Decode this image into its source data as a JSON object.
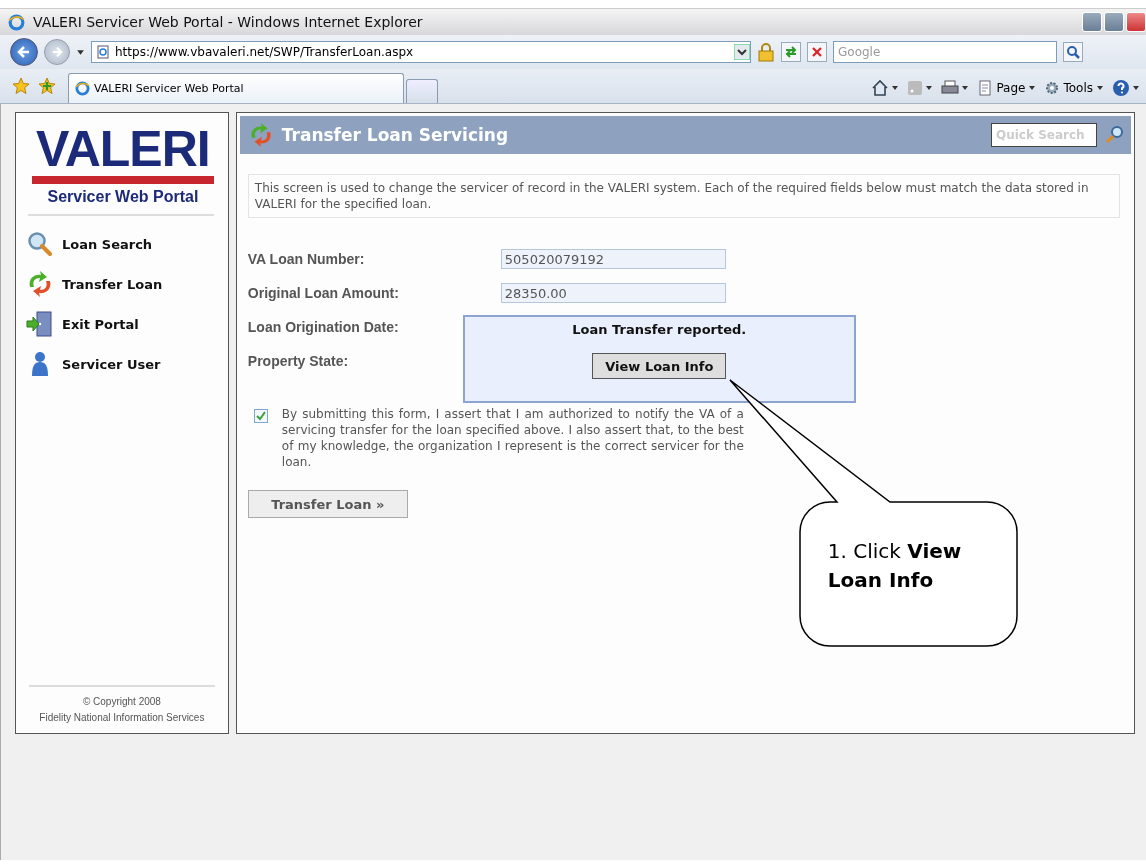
{
  "window": {
    "title": "VALERI Servicer Web Portal - Windows Internet Explorer"
  },
  "address_bar": {
    "url": "https://www.vbavaleri.net/SWP/TransferLoan.aspx"
  },
  "search_box": {
    "placeholder": "Google"
  },
  "tabs": [
    {
      "label": "VALERI Servicer Web Portal",
      "selected": true
    }
  ],
  "command_bar": [
    "Page",
    "Tools"
  ],
  "sidebar": {
    "logo": {
      "title": "VALERI",
      "subtitle": "Servicer Web Portal"
    },
    "items": [
      {
        "label": "Loan Search",
        "kind": "search"
      },
      {
        "label": "Transfer Loan",
        "kind": "transfer"
      },
      {
        "label": "Exit Portal",
        "kind": "exit"
      },
      {
        "label": "Servicer User",
        "kind": "user"
      }
    ],
    "copyright": "© Copyright 2008",
    "company": "Fidelity National Information Services"
  },
  "page": {
    "title": "Transfer Loan Servicing",
    "quick_search": {
      "placeholder": "Quick Search"
    },
    "intro": "This screen is used to change the servicer of record in the VALERI system. Each of the required fields below must match the data stored in VALERI for the specified loan.",
    "fields": [
      {
        "label": "VA Loan Number:",
        "value": "505020079192"
      },
      {
        "label": "Original Loan Amount:",
        "value": "28350.00"
      },
      {
        "label": "Loan Origination Date:"
      },
      {
        "label": "Property State:"
      }
    ],
    "agreement": {
      "checked": true,
      "text": "By submitting this form, I assert that I am authorized to notify the VA of a servicing transfer for the loan specified above. I also assert that, to the best of my knowledge, the organization I represent is the correct servicer for the loan."
    },
    "submit_button": "Transfer Loan »"
  },
  "popup": {
    "message": "Loan Transfer reported.",
    "button": "View Loan Info"
  },
  "callout": {
    "text": "1. Click **View Loan Info**"
  }
}
